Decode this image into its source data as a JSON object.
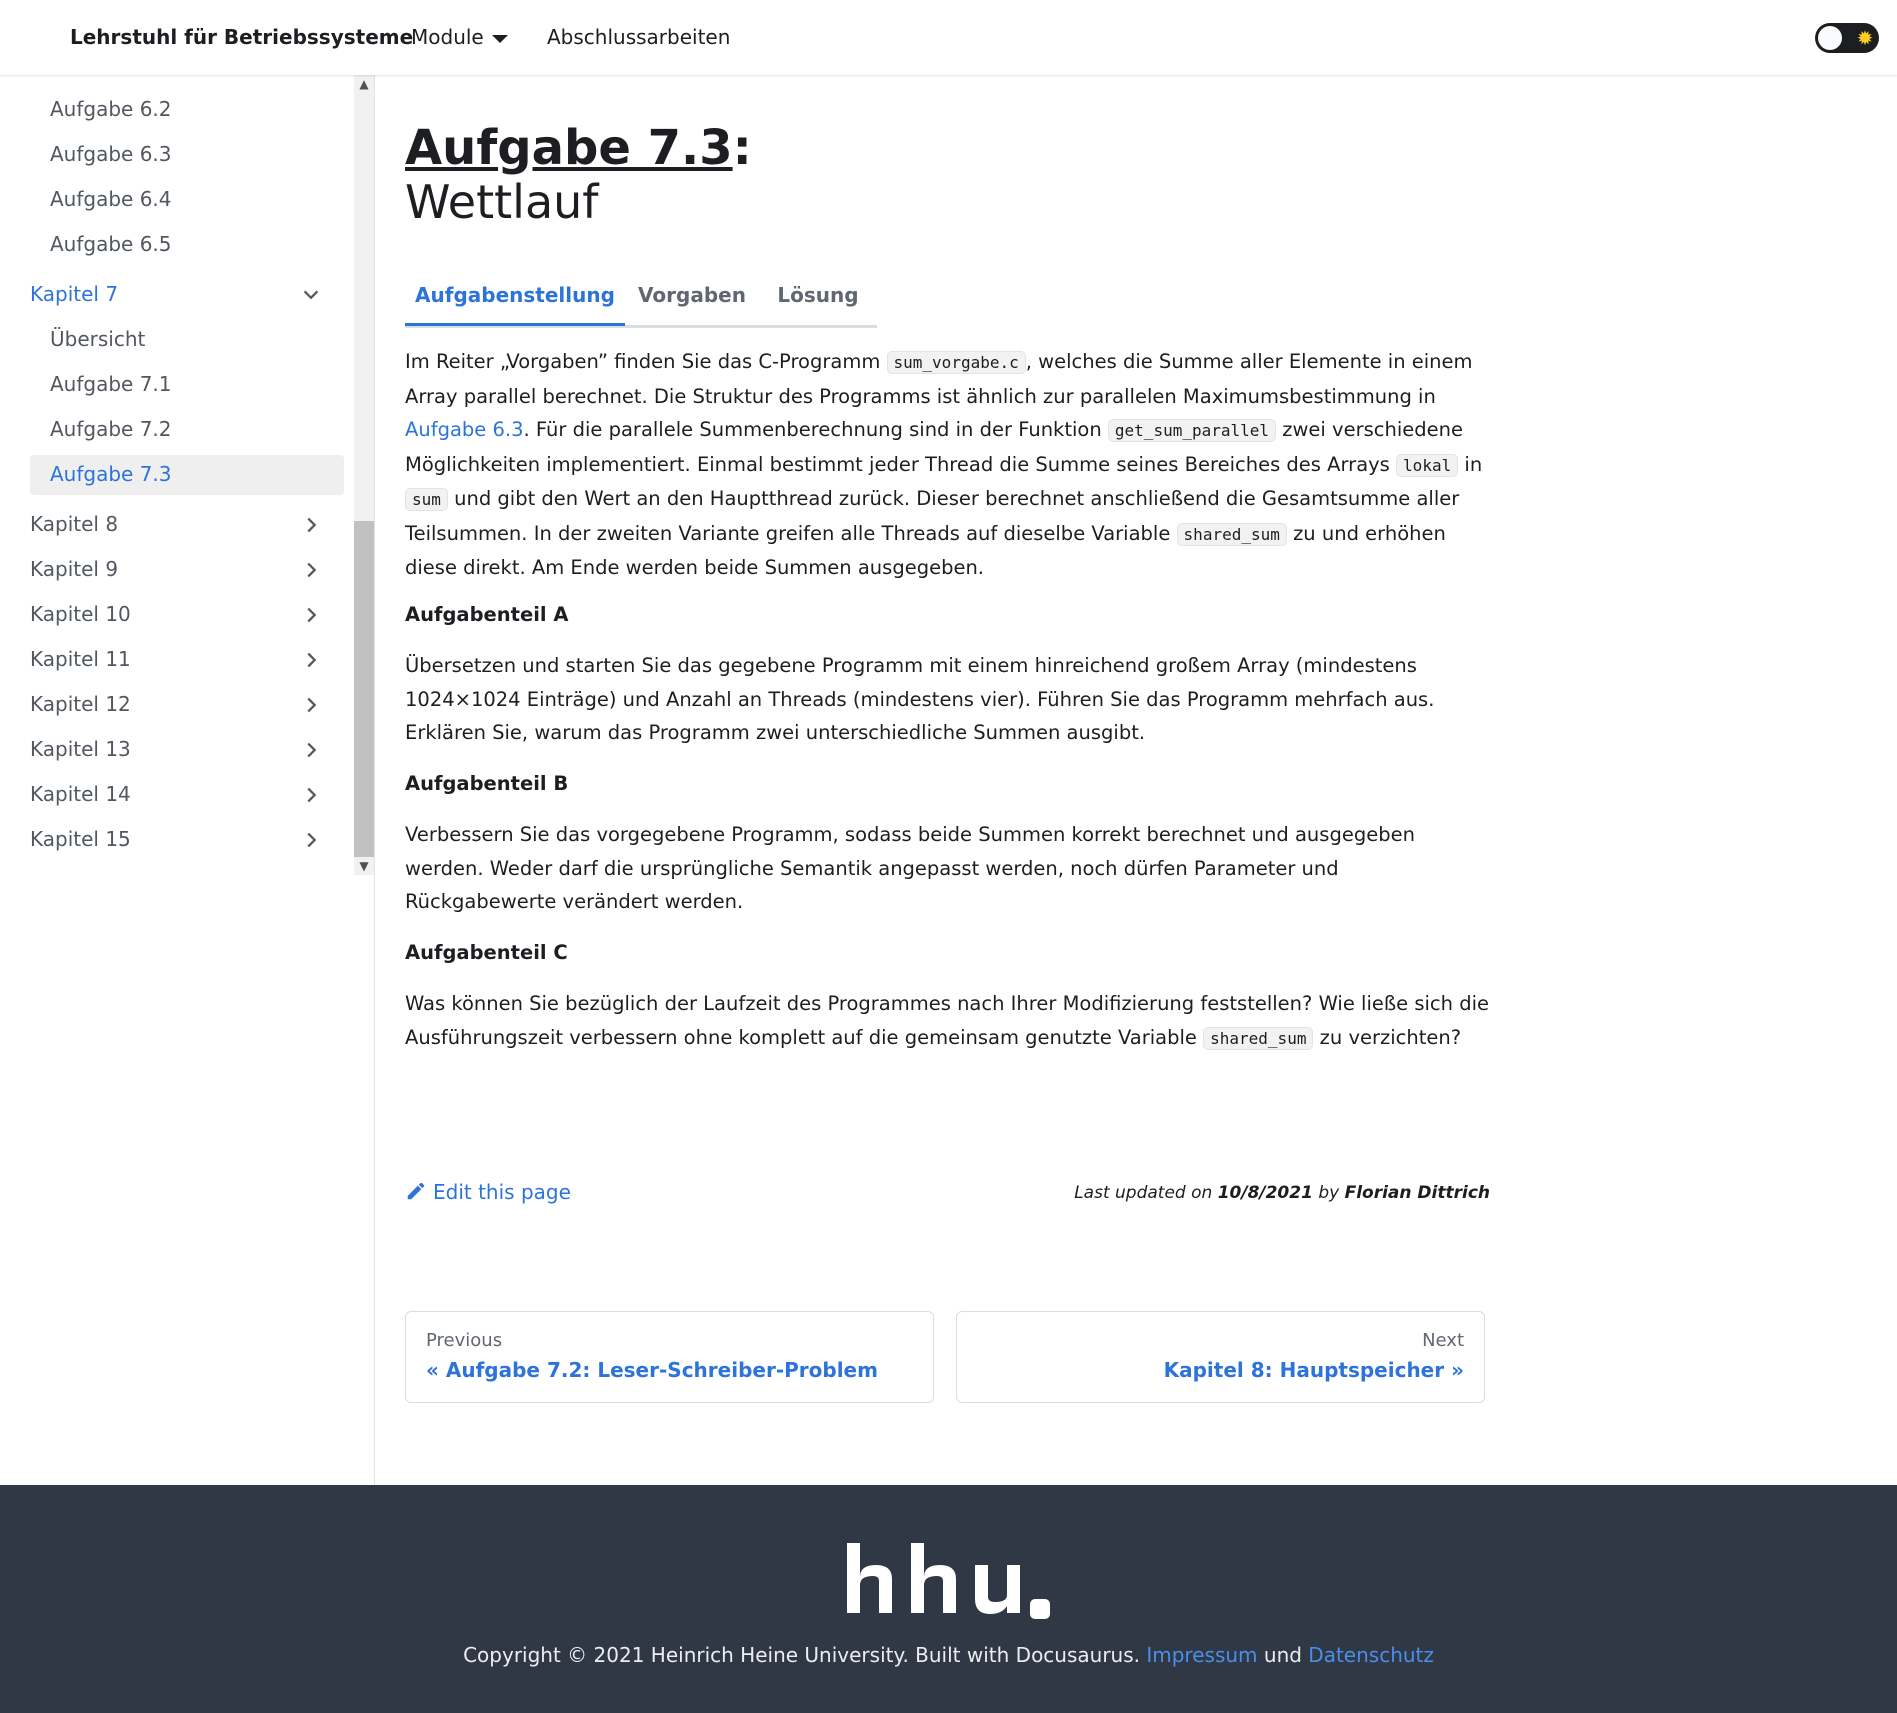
{
  "navbar": {
    "brand": "Lehrstuhl für Betriebssysteme",
    "modules_label": "Module",
    "theses_label": "Abschlussarbeiten"
  },
  "sidebar": {
    "items_top": [
      "Aufgabe 6.2",
      "Aufgabe 6.3",
      "Aufgabe 6.4",
      "Aufgabe 6.5"
    ],
    "active_category": "Kapitel 7",
    "active_children": [
      "Übersicht",
      "Aufgabe 7.1",
      "Aufgabe 7.2",
      "Aufgabe 7.3"
    ],
    "categories": [
      "Kapitel 8",
      "Kapitel 9",
      "Kapitel 10",
      "Kapitel 11",
      "Kapitel 12",
      "Kapitel 13",
      "Kapitel 14",
      "Kapitel 15"
    ]
  },
  "main": {
    "title_link": "Aufgabe 7.3",
    "title_colon": ":",
    "subtitle": "Wettlauf",
    "tabs": [
      "Aufgabenstellung",
      "Vorgaben",
      "Lösung"
    ],
    "intro": {
      "t1": "Im Reiter „Vorgaben” finden Sie das C-Programm ",
      "c1": "sum_vorgabe.c",
      "t2": ", welches die Summe aller Elemente in einem Array parallel berechnet. Die Struktur des Programms ist ähnlich zur parallelen Maximumsbestimmung in ",
      "link": "Aufgabe 6.3",
      "t3": ". Für die parallele Summenberechnung sind in der Funktion ",
      "c2": "get_sum_parallel",
      "t4": " zwei verschiedene Möglichkeiten implementiert. Einmal bestimmt jeder Thread die Summe seines Bereiches des Arrays ",
      "c3": "lokal",
      "t5": " in ",
      "c4": "sum",
      "t6": " und gibt den Wert an den Hauptthread zurück. Dieser berechnet anschließend die Gesamtsumme aller Teilsummen. In der zweiten Variante greifen alle Threads auf dieselbe Variable ",
      "c5": "shared_sum",
      "t7": " zu und erhöhen diese direkt. Am Ende werden beide Summen ausgegeben."
    },
    "part_a": {
      "heading": "Aufgabenteil A",
      "text": "Übersetzen und starten Sie das gegebene Programm mit einem hinreichend großem Array (mindestens 1024×1024 Einträge) und Anzahl an Threads (mindestens vier). Führen Sie das Programm mehrfach aus. Erklären Sie, warum das Programm zwei unterschiedliche Summen ausgibt."
    },
    "part_b": {
      "heading": "Aufgabenteil B",
      "text": "Verbessern Sie das vorgegebene Programm, sodass beide Summen korrekt berechnet und ausgegeben werden. Weder darf die ursprüngliche Semantik angepasst werden, noch dürfen Parameter und Rückgabewerte verändert werden."
    },
    "part_c": {
      "heading": "Aufgabenteil C",
      "t1": "Was können Sie bezüglich der Laufzeit des Programmes nach Ihrer Modifizierung feststellen? Wie ließe sich die Ausführungszeit verbessern ohne komplett auf die gemeinsam genutzte Variable ",
      "c1": "shared_sum",
      "t2": " zu verzichten?"
    },
    "edit_label": "Edit this page",
    "updated": {
      "prefix": "Last updated on ",
      "date": "10/8/2021",
      "by": " by ",
      "author": "Florian Dittrich"
    },
    "pager": {
      "prev_sub": "Previous",
      "prev_label": "« Aufgabe 7.2: Leser-Schreiber-Problem",
      "next_sub": "Next",
      "next_label": "Kapitel 8: Hauptspeicher »"
    }
  },
  "footer": {
    "logo_text": "hhu.",
    "copyright": "Copyright © 2021 Heinrich Heine University. Built with Docusaurus. ",
    "impressum": "Impressum",
    "und": " und ",
    "datenschutz": "Datenschutz"
  },
  "colors": {
    "accent": "#2e74d8",
    "footer_bg": "#303846",
    "text": "#1c1e21"
  },
  "icons": {
    "modules_caret": "caret-down-icon",
    "theme_toggle": "sun-icon",
    "chevron_open": "chevron-down-icon",
    "chevron_closed": "chevron-right-icon",
    "edit": "pencil-icon"
  }
}
